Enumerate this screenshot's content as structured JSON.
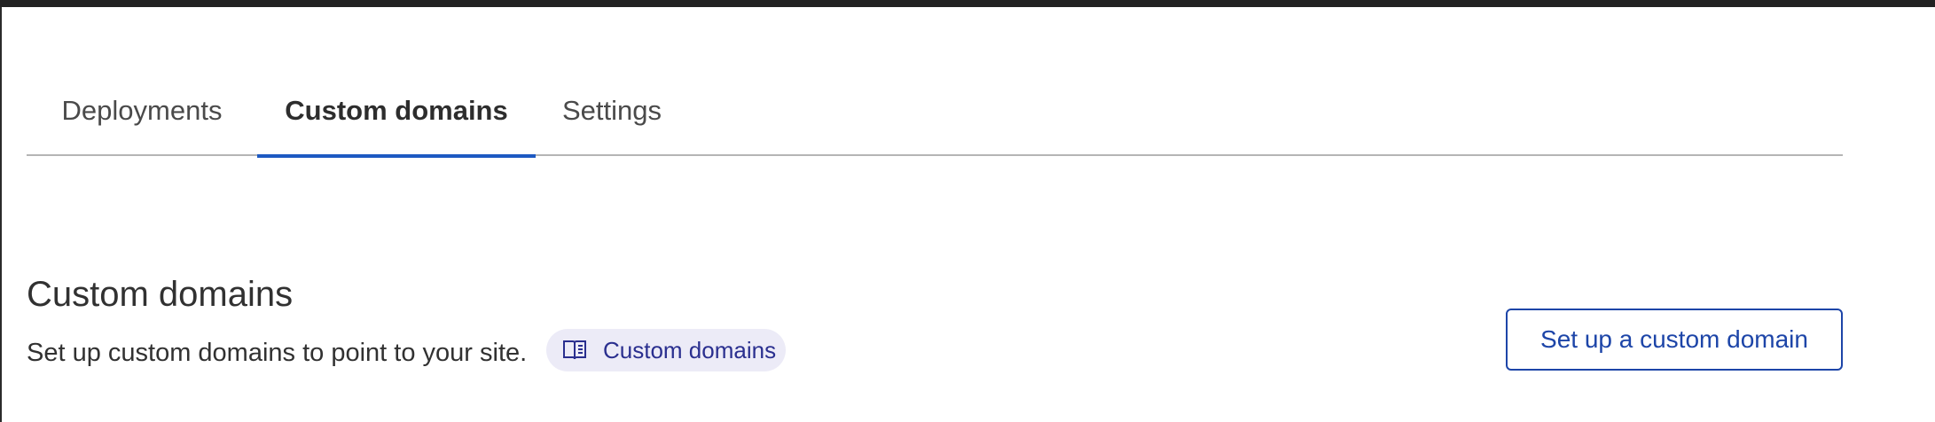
{
  "tabs": [
    {
      "label": "Deployments"
    },
    {
      "label": "Custom domains",
      "active": true
    },
    {
      "label": "Settings"
    }
  ],
  "section": {
    "title": "Custom domains",
    "description": "Set up custom domains to point to your site.",
    "docs_link": {
      "label": "Custom domains",
      "icon": "book-icon"
    },
    "action_button": {
      "label": "Set up a custom domain"
    }
  },
  "colors": {
    "accent": "#1d59c2",
    "button_border": "#1d45a8",
    "pill_background": "#ecebf7",
    "pill_text": "#2a2f8f"
  }
}
